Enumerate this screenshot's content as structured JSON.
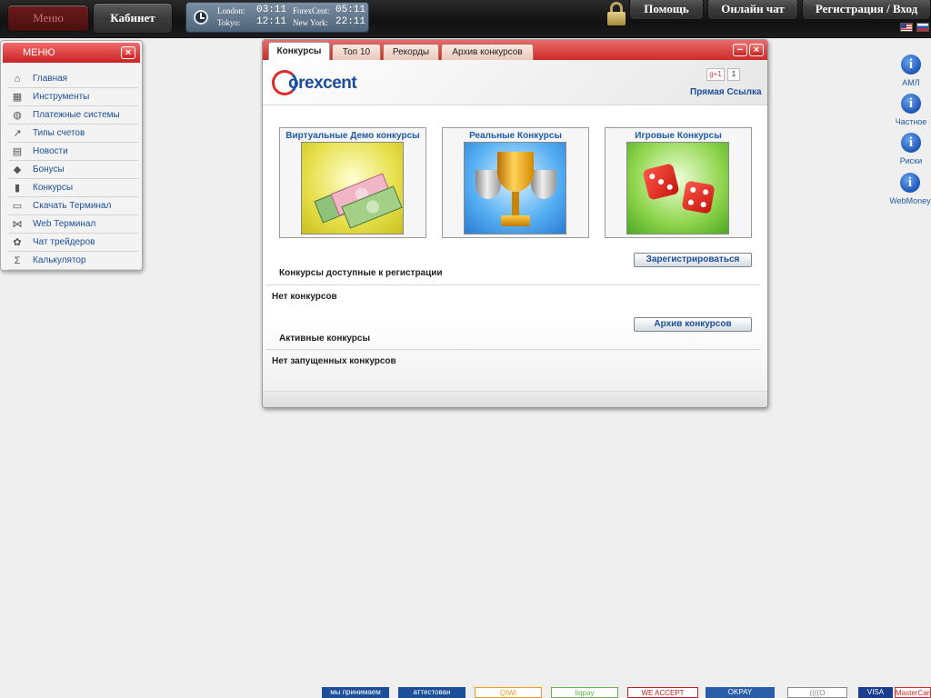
{
  "topbar": {
    "menu_label": "Меню",
    "cabinet_label": "Кабинет",
    "help_label": "Помощь",
    "chat_label": "Онлайн чат",
    "register_label": "Регистрация / Вход",
    "clocks": [
      {
        "city": "London:",
        "time": "03:11"
      },
      {
        "city": "ForexCent:",
        "time": "05:11"
      },
      {
        "city": "Tokyo:",
        "time": "12:11"
      },
      {
        "city": "New York:",
        "time": "22:11"
      }
    ]
  },
  "menu": {
    "title": "МЕНЮ",
    "close": "×",
    "items": [
      {
        "label": "Главная",
        "icon": "⌂"
      },
      {
        "label": "Инструменты",
        "icon": "▦"
      },
      {
        "label": "Платежные системы",
        "icon": "◍"
      },
      {
        "label": "Типы счетов",
        "icon": "↗"
      },
      {
        "label": "Новости",
        "icon": "▤"
      },
      {
        "label": "Бонусы",
        "icon": "◆"
      },
      {
        "label": "Конкурсы",
        "icon": "▮"
      },
      {
        "label": "Скачать Терминал",
        "icon": "▭"
      },
      {
        "label": "Web Терминал",
        "icon": "⋈"
      },
      {
        "label": "Чат трейдеров",
        "icon": "✿"
      },
      {
        "label": "Калькулятор",
        "icon": "Σ"
      }
    ]
  },
  "window": {
    "tabs": [
      "Конкурсы",
      "Топ 10",
      "Рекорды",
      "Архив конкурсов"
    ],
    "active_tab": 0,
    "minimize": "−",
    "close": "×",
    "logo_text": "orexcent",
    "gplus": "g+1",
    "gplus_count": "1",
    "direct_link": "Прямая Ссылка",
    "cards": [
      {
        "title": "Виртуальные Демо конкурсы"
      },
      {
        "title": "Реальные Конкурсы"
      },
      {
        "title": "Игровые Конкурсы"
      }
    ],
    "register_button": "Зарегистрироваться",
    "available_title": "Конкурсы доступные к регистрации",
    "available_empty": "Нет конкурсов",
    "archive_button": "Архив конкурсов",
    "active_title": "Активные конкурсы",
    "active_empty": "Нет запущенных конкурсов"
  },
  "info_links": [
    {
      "label": "АМЛ",
      "icon": "i"
    },
    {
      "label": "Частное",
      "icon": "i"
    },
    {
      "label": "Риски",
      "icon": "i"
    },
    {
      "label": "WebMoney",
      "icon": "i"
    }
  ],
  "payments": [
    {
      "label": "мы принимаем",
      "color": "#1b4f9a"
    },
    {
      "label": "аттестован",
      "color": "#1b4f9a"
    },
    {
      "label": "QIWI",
      "color": "#f39a1e"
    },
    {
      "label": "liqpay",
      "color": "#6ab04c"
    },
    {
      "label": "WE ACCEPT",
      "color": "#c62020"
    },
    {
      "label": "OKPAY",
      "color": "#2a5ea8"
    },
    {
      "label": "((((O",
      "color": "#888888"
    },
    {
      "label": "VISA",
      "color": "#1a3d8f"
    },
    {
      "label": "MasterCard",
      "color": "#e0292a"
    }
  ]
}
